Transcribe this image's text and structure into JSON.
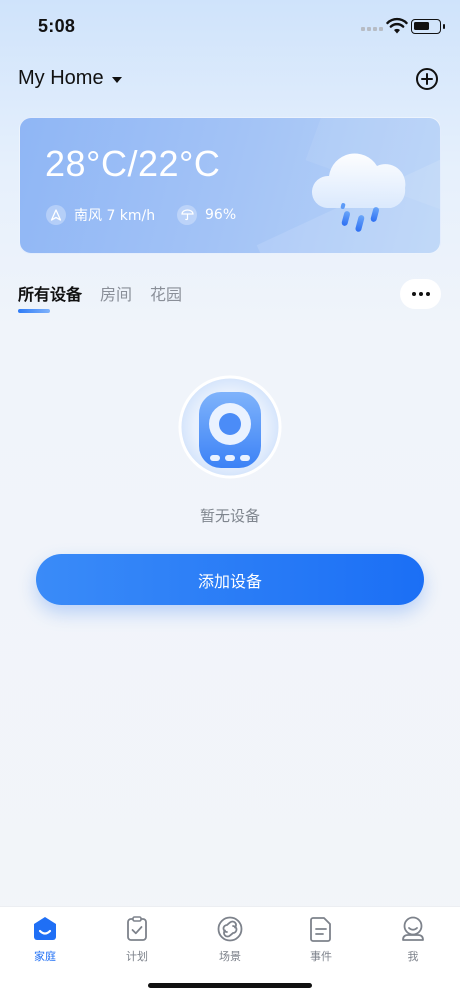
{
  "status_bar": {
    "time": "5:08"
  },
  "header": {
    "home_name": "My Home"
  },
  "weather": {
    "temperature": "28°C/22°C",
    "wind": "南风 7 km/h",
    "humidity": "96%"
  },
  "tabs": [
    {
      "label": "所有设备",
      "active": true
    },
    {
      "label": "房间",
      "active": false
    },
    {
      "label": "花园",
      "active": false
    }
  ],
  "empty_state": {
    "message": "暂无设备"
  },
  "actions": {
    "add_device": "添加设备"
  },
  "bottom_nav": [
    {
      "label": "家庭",
      "icon": "home-icon",
      "active": true
    },
    {
      "label": "计划",
      "icon": "plan-icon",
      "active": false
    },
    {
      "label": "场景",
      "icon": "scene-icon",
      "active": false
    },
    {
      "label": "事件",
      "icon": "event-icon",
      "active": false
    },
    {
      "label": "我",
      "icon": "profile-icon",
      "active": false
    }
  ],
  "colors": {
    "accent": "#1f6ff5",
    "card": "#a3c3f6",
    "inactive": "#7d828b"
  }
}
